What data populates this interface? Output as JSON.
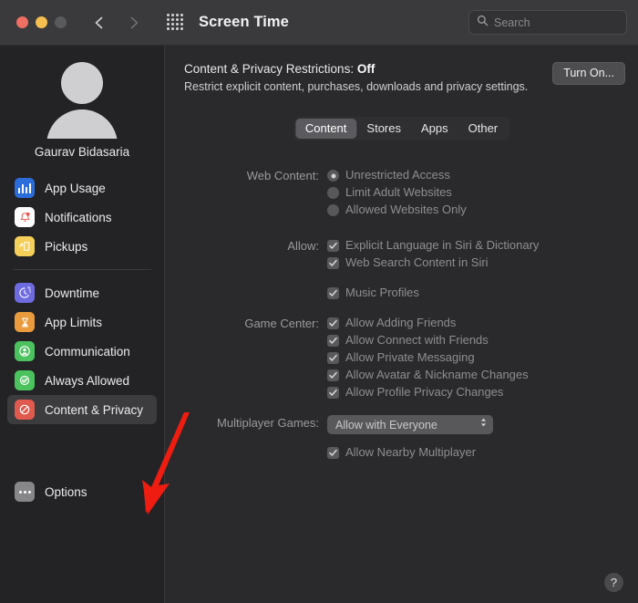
{
  "window": {
    "title": "Screen Time",
    "traffic_lights": [
      "close",
      "minimize",
      "zoom"
    ],
    "back_label": "Back",
    "forward_label": "Forward",
    "grid_label": "Show All Preferences"
  },
  "search": {
    "placeholder": "Search",
    "value": ""
  },
  "sidebar": {
    "user_name": "Gaurav Bidasaria",
    "group_one": [
      {
        "label": "App Usage",
        "icon": "bar-chart-icon",
        "color": "#2b6ddb"
      },
      {
        "label": "Notifications",
        "icon": "bell-icon",
        "color": "#fdfdfd"
      },
      {
        "label": "Pickups",
        "icon": "phone-pickup-icon",
        "color": "#f4cf5a"
      }
    ],
    "group_two": [
      {
        "label": "Downtime",
        "icon": "downtime-clock-icon",
        "color": "#6e6ae0"
      },
      {
        "label": "App Limits",
        "icon": "hourglass-icon",
        "color": "#e99b3e"
      },
      {
        "label": "Communication",
        "icon": "person-circle-icon",
        "color": "#4cc25e"
      },
      {
        "label": "Always Allowed",
        "icon": "checkmark-badge-icon",
        "color": "#4cc25e"
      },
      {
        "label": "Content & Privacy",
        "icon": "prohibited-icon",
        "color": "#e05a4d",
        "selected": true
      }
    ],
    "group_three": [
      {
        "label": "Options",
        "icon": "ellipsis-icon",
        "color": "#87878a"
      }
    ]
  },
  "main": {
    "header": {
      "title_prefix": "Content & Privacy Restrictions:",
      "status": "Off",
      "subtitle": "Restrict explicit content, purchases, downloads and privacy settings.",
      "action_button": "Turn On..."
    },
    "tabs": [
      {
        "label": "Content",
        "active": true
      },
      {
        "label": "Stores",
        "active": false
      },
      {
        "label": "Apps",
        "active": false
      },
      {
        "label": "Other",
        "active": false
      }
    ],
    "sections": {
      "web_content": {
        "label": "Web Content:",
        "options": [
          {
            "label": "Unrestricted Access",
            "selected": true
          },
          {
            "label": "Limit Adult Websites",
            "selected": false
          },
          {
            "label": "Allowed Websites Only",
            "selected": false
          }
        ]
      },
      "allow": {
        "label": "Allow:",
        "items": [
          {
            "label": "Explicit Language in Siri & Dictionary",
            "checked": true
          },
          {
            "label": "Web Search Content in Siri",
            "checked": true
          }
        ],
        "extra": [
          {
            "label": "Music Profiles",
            "checked": true
          }
        ]
      },
      "game_center": {
        "label": "Game Center:",
        "items": [
          {
            "label": "Allow Adding Friends",
            "checked": true
          },
          {
            "label": "Allow Connect with Friends",
            "checked": true
          },
          {
            "label": "Allow Private Messaging",
            "checked": true
          },
          {
            "label": "Allow Avatar & Nickname Changes",
            "checked": true
          },
          {
            "label": "Allow Profile Privacy Changes",
            "checked": true
          }
        ]
      },
      "multiplayer": {
        "label": "Multiplayer Games:",
        "selected_value": "Allow with Everyone",
        "items": [
          {
            "label": "Allow Nearby Multiplayer",
            "checked": true
          }
        ]
      }
    },
    "help_button": "?"
  },
  "annotation": {
    "arrow_color": "#ee1c11",
    "points_at": "Content & Privacy"
  }
}
